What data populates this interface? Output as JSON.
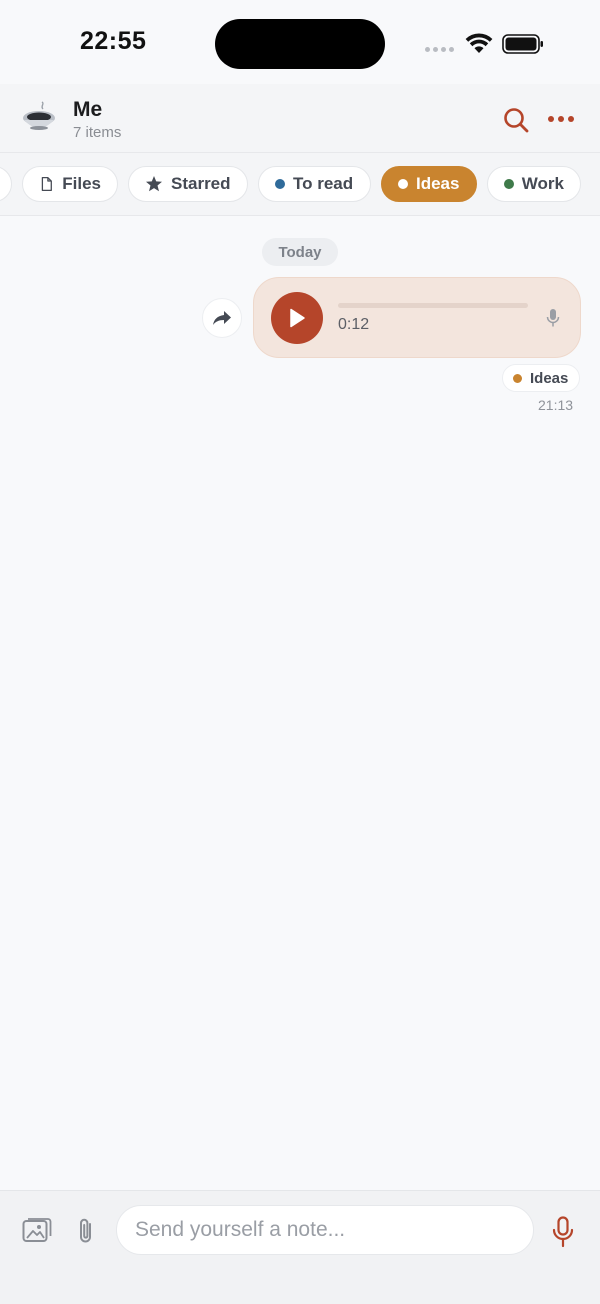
{
  "status_bar": {
    "time": "22:55"
  },
  "header": {
    "title": "Me",
    "subtitle": "7 items",
    "accent_color": "#b5452a"
  },
  "filters": {
    "chips": [
      {
        "label": "Files",
        "icon": "file-icon"
      },
      {
        "label": "Starred",
        "icon": "star-icon"
      },
      {
        "label": "To read",
        "dot_color": "#2f6b9a"
      },
      {
        "label": "Ideas",
        "dot_color": "#ffffff",
        "active": true
      },
      {
        "label": "Work",
        "dot_color": "#3f7a4a"
      }
    ]
  },
  "messages": {
    "date_label": "Today",
    "voice_note": {
      "duration": "0:12",
      "progress": 0.0,
      "tag_label": "Ideas",
      "tag_color": "#c9842f",
      "time": "21:13"
    }
  },
  "composer": {
    "placeholder": "Send yourself a note..."
  }
}
